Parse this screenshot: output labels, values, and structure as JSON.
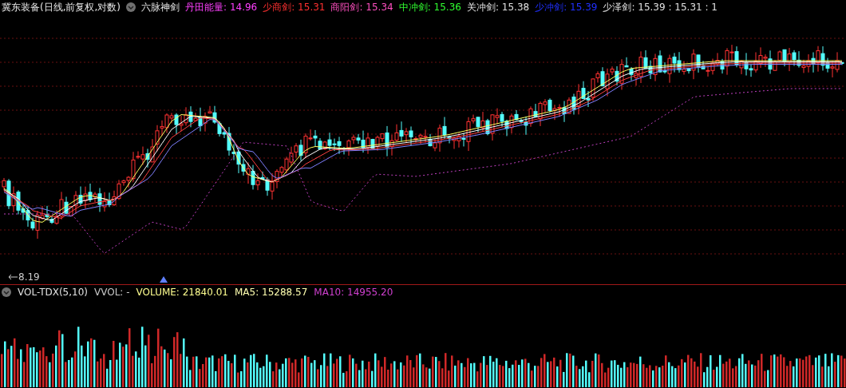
{
  "header": {
    "stock": "冀东装备(日线,前复权,对数)",
    "indicator": "六脉神剑"
  },
  "indicators": [
    {
      "label": "丹田能量:",
      "value": "14.96",
      "color": "#ff40ff"
    },
    {
      "label": "少商剑:",
      "value": "15.31",
      "color": "#ff3030"
    },
    {
      "label": "商阳剑:",
      "value": "15.34",
      "color": "#ff50c0"
    },
    {
      "label": "中冲剑:",
      "value": "15.36",
      "color": "#30ff30"
    },
    {
      "label": "关冲剑:",
      "value": "15.38",
      "color": "#e0e0e0"
    },
    {
      "label": "少冲剑:",
      "value": "15.39",
      "color": "#2030ff"
    },
    {
      "label": "少泽剑:",
      "value": "15.39 : 15.31 : 1",
      "color": "#e0e0e0"
    }
  ],
  "price_label": "8.19",
  "volume_panel": {
    "indicator": "VOL-TDX(5,10)",
    "fields": [
      {
        "label": "VVOL:",
        "value": "-",
        "color": "#c8c8c8"
      },
      {
        "label": "VOLUME:",
        "value": "21840.01",
        "color": "#ffff90"
      },
      {
        "label": "MA5:",
        "value": "15288.57",
        "color": "#ffffb0"
      },
      {
        "label": "MA10:",
        "value": "14955.20",
        "color": "#d040d0"
      }
    ]
  }
}
